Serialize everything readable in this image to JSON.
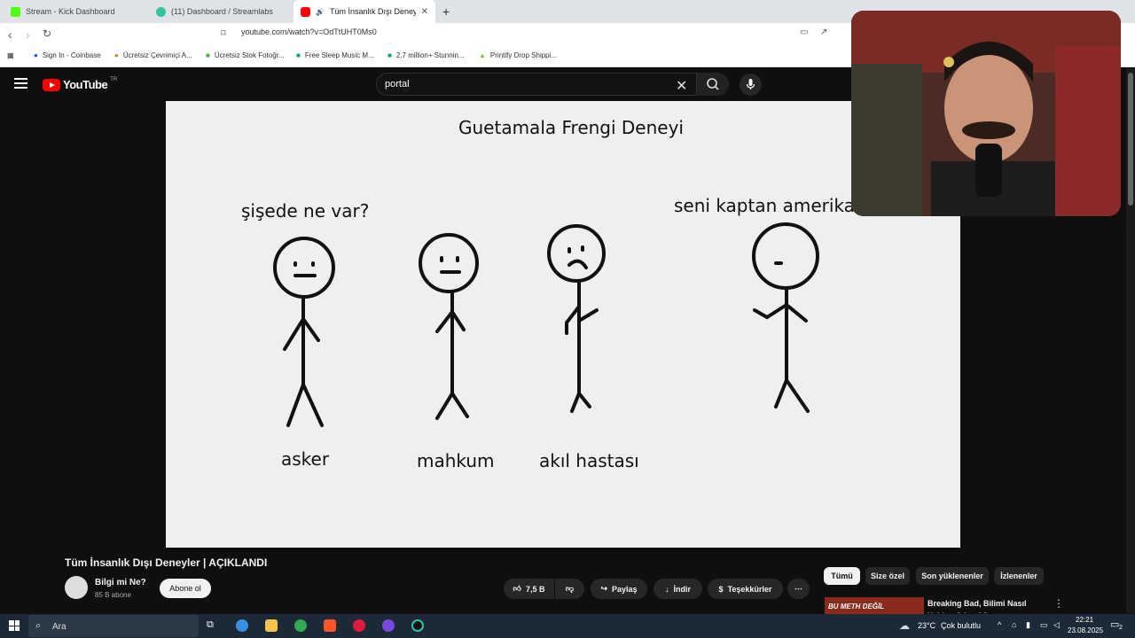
{
  "tabs": [
    {
      "label": "Stream - Kick Dashboard",
      "color": "#53fc18"
    },
    {
      "label": "(11) Dashboard / Streamlabs",
      "color": "#31c3a2"
    },
    {
      "label": "Tüm İnsanlık Dışı Deneyler | AÇIKLANDI",
      "color": "#ff0000"
    }
  ],
  "address_bar": {
    "url": "youtube.com/watch?v=OdTtUHT0Ms0"
  },
  "bookmarks": [
    {
      "label": "Sign In - Coinbase"
    },
    {
      "label": "Ücretsiz Çevrimiçi A..."
    },
    {
      "label": "Ücretsiz Stok Fotoğr..."
    },
    {
      "label": "Free Sleep Music M..."
    },
    {
      "label": "2.7 million+ Stunnin..."
    },
    {
      "label": "Printify Drop Shippi..."
    }
  ],
  "youtube": {
    "logo": "YouTube",
    "region": "TR",
    "search_query": "portal"
  },
  "video_frame": {
    "title": "Guetamala Frengi Deneyi",
    "speech_left": "şişede ne var?",
    "speech_right": "seni kaptan amerika y",
    "labels": [
      "asker",
      "mahkum",
      "akıl hastası"
    ]
  },
  "video": {
    "title": "Tüm İnsanlık Dışı Deneyler | AÇIKLANDI",
    "channel": "Bilgi mi Ne?",
    "subscribers": "85 B abone",
    "subscribe_label": "Abone ol",
    "likes": "7,5 B",
    "share_label": "Paylaş",
    "download_label": "İndir",
    "thanks_label": "Teşekkürler",
    "more": "⋯"
  },
  "chips": [
    "Tümü",
    "Size özel",
    "Son yüklenenler",
    "İzlenenler"
  ],
  "recommendation": {
    "thumb_text": "BU METH DEĞİL",
    "title": "Breaking Bad, Bilimi Nasıl Yoldan Çıkardı?"
  },
  "taskbar": {
    "search_placeholder": "Ara",
    "temperature": "23°C",
    "weather": "Çok bulutlu",
    "time": "22:21",
    "date": "23.08.2025",
    "notifications": "2"
  }
}
